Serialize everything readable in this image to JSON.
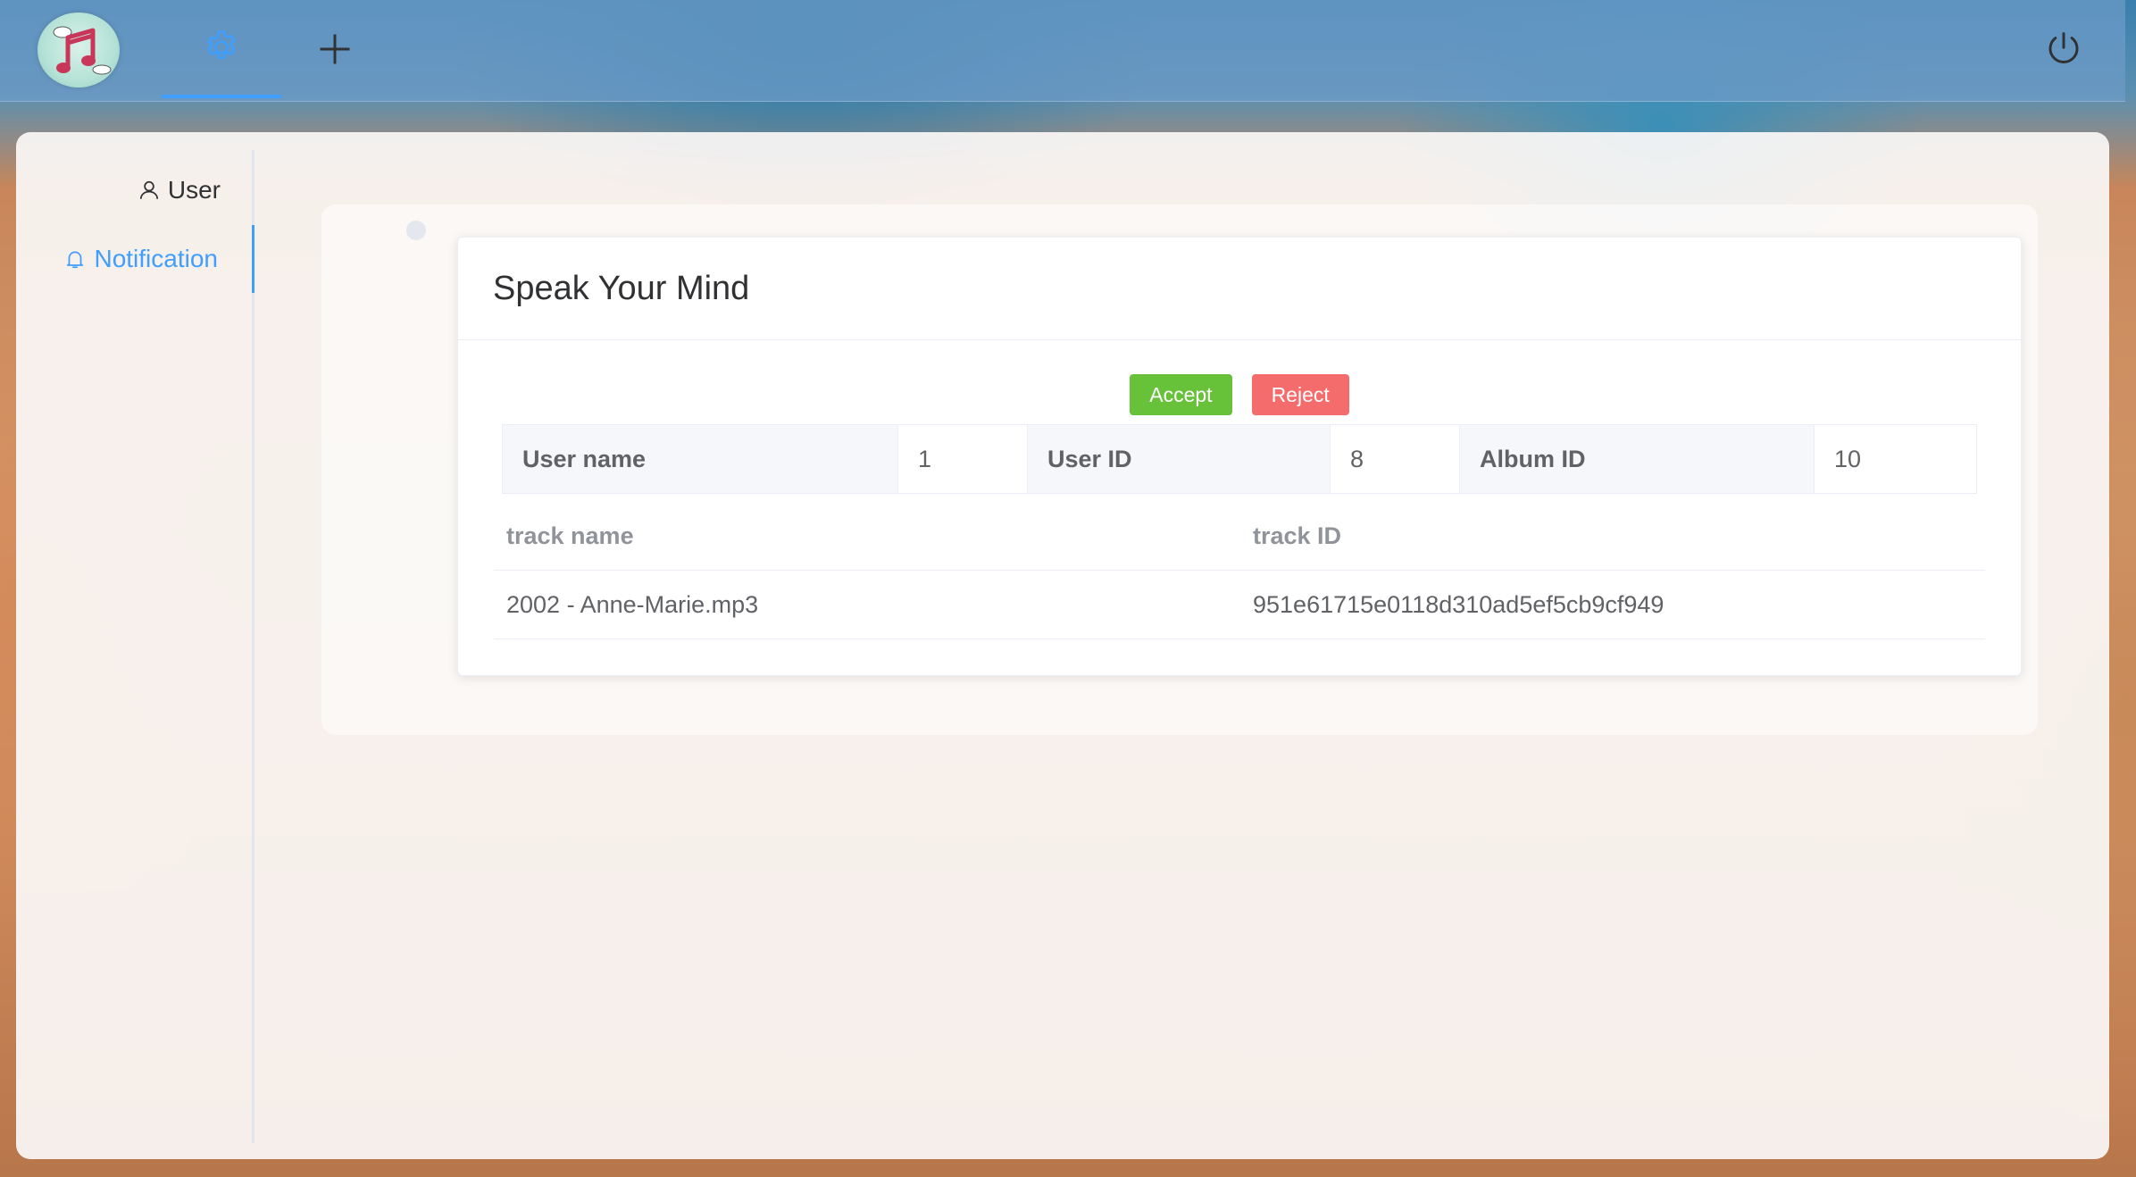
{
  "topbar": {
    "logo": "music-notes-logo",
    "tabs": [
      {
        "icon": "gear-icon",
        "active": true
      },
      {
        "icon": "plus-icon",
        "active": false
      }
    ],
    "power_icon": "power-icon"
  },
  "sidebar": {
    "items": [
      {
        "label": "User",
        "icon": "user-icon",
        "active": false
      },
      {
        "label": "Notification",
        "icon": "bell-icon",
        "active": true
      }
    ]
  },
  "notification": {
    "title": "Speak Your Mind",
    "accept_label": "Accept",
    "reject_label": "Reject",
    "details": {
      "user_name_label": "User name",
      "user_name_value": "1",
      "user_id_label": "User ID",
      "user_id_value": "8",
      "album_id_label": "Album ID",
      "album_id_value": "10"
    },
    "tracks": {
      "headers": [
        "track name",
        "track ID"
      ],
      "rows": [
        [
          "2002 - Anne-Marie.mp3",
          "951e61715e0118d310ad5ef5cb9cf949"
        ]
      ]
    }
  },
  "colors": {
    "accent": "#409eff",
    "accept": "#67c23a",
    "reject": "#f56c6c"
  }
}
